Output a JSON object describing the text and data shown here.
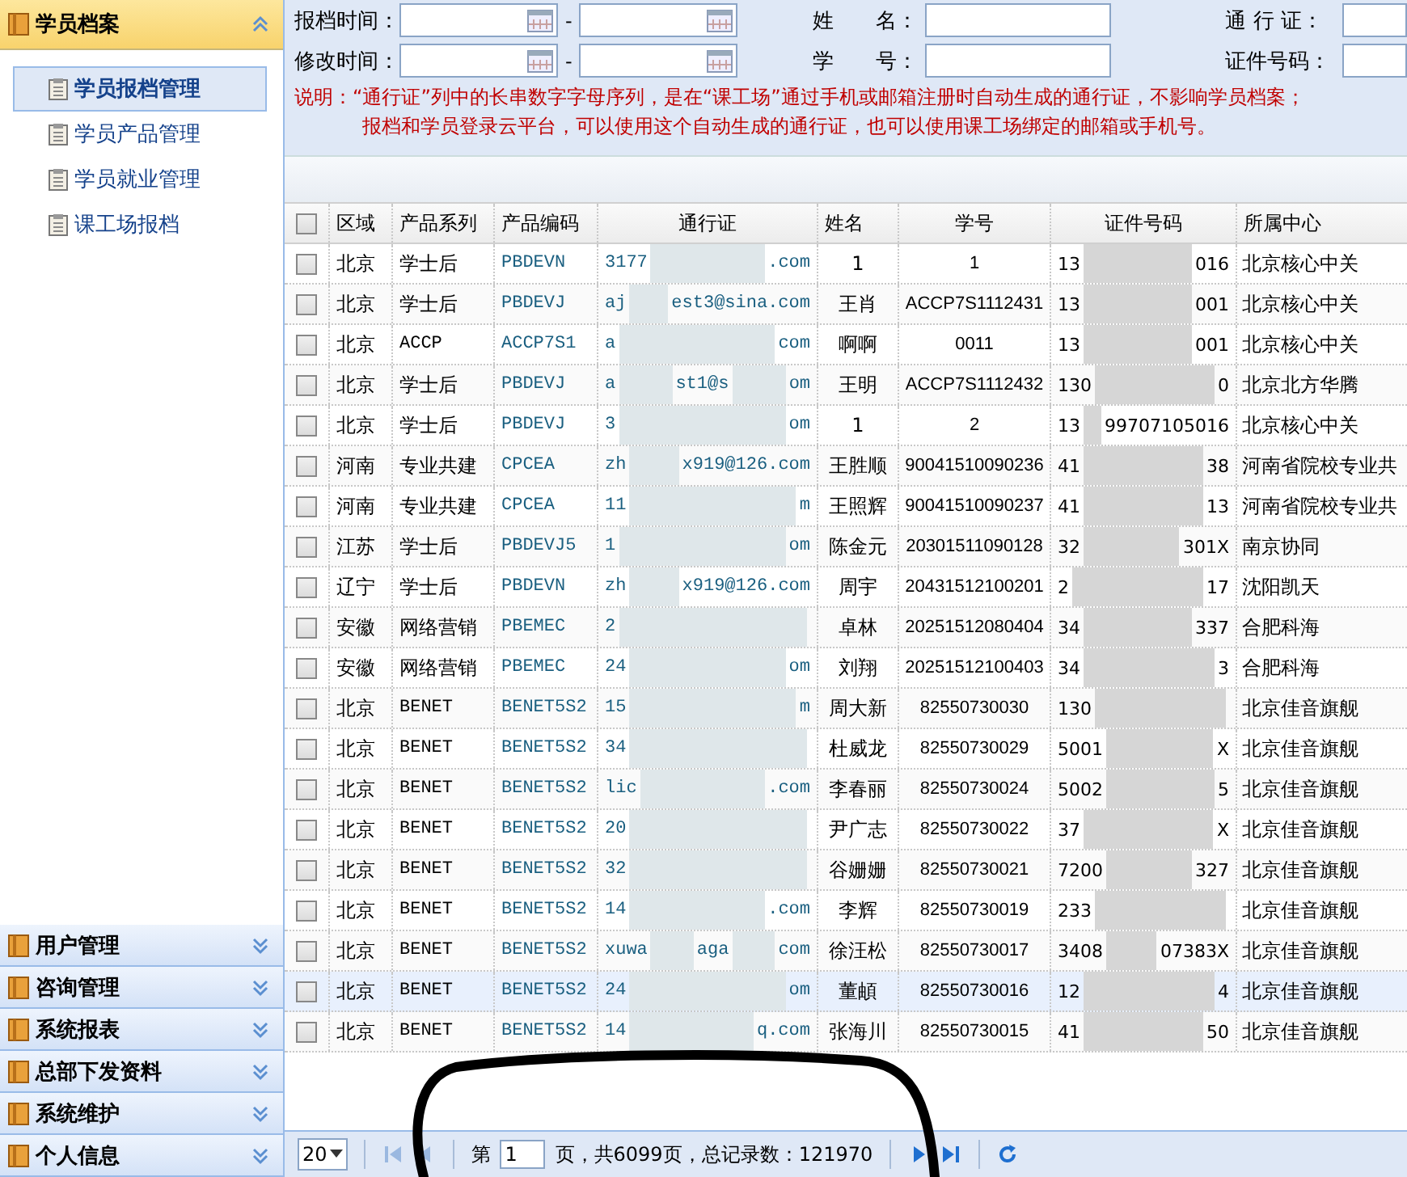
{
  "sidebar": {
    "open_section": {
      "title": "学员档案",
      "expanded": true,
      "items": [
        {
          "label": "学员报档管理",
          "selected": true
        },
        {
          "label": "学员产品管理",
          "selected": false
        },
        {
          "label": "学员就业管理",
          "selected": false
        },
        {
          "label": "课工场报档",
          "selected": false
        }
      ]
    },
    "sections": [
      {
        "title": "用户管理",
        "expanded": false
      },
      {
        "title": "咨询管理",
        "expanded": false
      },
      {
        "title": "系统报表",
        "expanded": false
      },
      {
        "title": "总部下发资料",
        "expanded": false
      },
      {
        "title": "系统维护",
        "expanded": false
      },
      {
        "title": "个人信息",
        "expanded": false
      }
    ]
  },
  "search": {
    "rows": [
      {
        "label": "报档时间：",
        "kind": "range",
        "label2": "姓　　名：",
        "label3": "通 行 证："
      },
      {
        "label": "修改时间：",
        "kind": "range",
        "label2": "学　　号：",
        "label3": "证件号码："
      }
    ],
    "range_separator": "-",
    "note": [
      "说明：“通行证”列中的长串数字字母序列，是在“课工场”通过手机或邮箱注册时自动生成的通行证，不影响学员档案；",
      "报档和学员登录云平台，可以使用这个自动生成的通行证，也可以使用课工场绑定的邮箱或手机号。"
    ]
  },
  "table": {
    "header_checked": false,
    "columns": [
      "区域",
      "产品系列",
      "产品编码",
      "通行证",
      "姓名",
      "学号",
      "证件号码",
      "所属中心"
    ],
    "rows": [
      {
        "checked": false,
        "selected": false,
        "region": "北京",
        "series": "学士后",
        "code": "PBDEVN",
        "pass": [
          "3177",
          ".com"
        ],
        "name": "1",
        "student_no": "1",
        "id_no": [
          "13",
          "016"
        ],
        "center": "北京核心中关"
      },
      {
        "checked": false,
        "selected": false,
        "region": "北京",
        "series": "学士后",
        "code": "PBDEVJ",
        "pass": [
          "aj",
          "est3@sina.com"
        ],
        "name": "王肖",
        "student_no": "ACCP7S1112431",
        "id_no": [
          "13",
          "001"
        ],
        "center": "北京核心中关"
      },
      {
        "checked": false,
        "selected": false,
        "region": "北京",
        "series": "ACCP",
        "code": "ACCP7S1",
        "pass": [
          "a",
          "com"
        ],
        "name": "啊啊",
        "student_no": "0011",
        "id_no": [
          "13",
          "001"
        ],
        "center": "北京核心中关"
      },
      {
        "checked": false,
        "selected": false,
        "region": "北京",
        "series": "学士后",
        "code": "PBDEVJ",
        "pass": [
          "a",
          "st1@s",
          "om"
        ],
        "name": "王明",
        "student_no": "ACCP7S1112432",
        "id_no": [
          "130",
          "0"
        ],
        "center": "北京北方华腾"
      },
      {
        "checked": false,
        "selected": false,
        "region": "北京",
        "series": "学士后",
        "code": "PBDEVJ",
        "pass": [
          "3",
          "om"
        ],
        "name": "1",
        "student_no": "2",
        "id_no": [
          "13",
          "99707105016"
        ],
        "center": "北京核心中关"
      },
      {
        "checked": false,
        "selected": false,
        "region": "河南",
        "series": "专业共建",
        "code": "CPCEA",
        "pass": [
          "zh",
          "x919@126.com"
        ],
        "name": "王胜顺",
        "student_no": "90041510090236",
        "id_no": [
          "41",
          "38"
        ],
        "center": "河南省院校专业共"
      },
      {
        "checked": false,
        "selected": false,
        "region": "河南",
        "series": "专业共建",
        "code": "CPCEA",
        "pass": [
          "11",
          "m"
        ],
        "name": "王照辉",
        "student_no": "90041510090237",
        "id_no": [
          "41",
          "13"
        ],
        "center": "河南省院校专业共"
      },
      {
        "checked": false,
        "selected": false,
        "region": "江苏",
        "series": "学士后",
        "code": "PBDEVJ5",
        "pass": [
          "1",
          "om"
        ],
        "name": "陈金元",
        "student_no": "20301511090128",
        "id_no": [
          "32",
          "301X"
        ],
        "center": "南京协同"
      },
      {
        "checked": false,
        "selected": false,
        "region": "辽宁",
        "series": "学士后",
        "code": "PBDEVN",
        "pass": [
          "zh",
          "x919@126.com"
        ],
        "name": "周宇",
        "student_no": "20431512100201",
        "id_no": [
          "2",
          "17"
        ],
        "center": "沈阳凯天"
      },
      {
        "checked": false,
        "selected": false,
        "region": "安徽",
        "series": "网络营销",
        "code": "PBEMEC",
        "pass": [
          "2"
        ],
        "name": "卓林",
        "student_no": "20251512080404",
        "id_no": [
          "34",
          "337"
        ],
        "center": "合肥科海"
      },
      {
        "checked": false,
        "selected": false,
        "region": "安徽",
        "series": "网络营销",
        "code": "PBEMEC",
        "pass": [
          "24",
          "om"
        ],
        "name": "刘翔",
        "student_no": "20251512100403",
        "id_no": [
          "34",
          "3"
        ],
        "center": "合肥科海"
      },
      {
        "checked": false,
        "selected": false,
        "region": "北京",
        "series": "BENET",
        "code": "BENET5S2",
        "pass": [
          "15",
          "m"
        ],
        "name": "周大新",
        "student_no": "82550730030",
        "id_no": [
          "130"
        ],
        "center": "北京佳音旗舰"
      },
      {
        "checked": false,
        "selected": false,
        "region": "北京",
        "series": "BENET",
        "code": "BENET5S2",
        "pass": [
          "34"
        ],
        "name": "杜威龙",
        "student_no": "82550730029",
        "id_no": [
          "5001",
          "X"
        ],
        "center": "北京佳音旗舰"
      },
      {
        "checked": false,
        "selected": false,
        "region": "北京",
        "series": "BENET",
        "code": "BENET5S2",
        "pass": [
          "lic",
          ".com"
        ],
        "name": "李春丽",
        "student_no": "82550730024",
        "id_no": [
          "5002",
          "5"
        ],
        "center": "北京佳音旗舰"
      },
      {
        "checked": false,
        "selected": false,
        "region": "北京",
        "series": "BENET",
        "code": "BENET5S2",
        "pass": [
          "20"
        ],
        "name": "尹广志",
        "student_no": "82550730022",
        "id_no": [
          "37",
          "X"
        ],
        "center": "北京佳音旗舰"
      },
      {
        "checked": false,
        "selected": false,
        "region": "北京",
        "series": "BENET",
        "code": "BENET5S2",
        "pass": [
          "32"
        ],
        "name": "谷姗姗",
        "student_no": "82550730021",
        "id_no": [
          "7200",
          "327"
        ],
        "center": "北京佳音旗舰"
      },
      {
        "checked": false,
        "selected": false,
        "region": "北京",
        "series": "BENET",
        "code": "BENET5S2",
        "pass": [
          "14",
          ".com"
        ],
        "name": "李辉",
        "student_no": "82550730019",
        "id_no": [
          "233"
        ],
        "center": "北京佳音旗舰"
      },
      {
        "checked": false,
        "selected": false,
        "region": "北京",
        "series": "BENET",
        "code": "BENET5S2",
        "pass": [
          "xuwa",
          "aga",
          "com"
        ],
        "name": "徐汪松",
        "student_no": "82550730017",
        "id_no": [
          "3408",
          "07383X"
        ],
        "center": "北京佳音旗舰"
      },
      {
        "checked": false,
        "selected": true,
        "region": "北京",
        "series": "BENET",
        "code": "BENET5S2",
        "pass": [
          "24",
          "om"
        ],
        "name": "董頔",
        "student_no": "82550730016",
        "id_no": [
          "12",
          "4"
        ],
        "center": "北京佳音旗舰"
      },
      {
        "checked": false,
        "selected": false,
        "region": "北京",
        "series": "BENET",
        "code": "BENET5S2",
        "pass": [
          "14",
          "q.com"
        ],
        "name": "张海川",
        "student_no": "82550730015",
        "id_no": [
          "41",
          "50"
        ],
        "center": "北京佳音旗舰"
      }
    ]
  },
  "pager": {
    "page_size": "20",
    "page_prefix": "第",
    "page": "1",
    "page_suffix": "页，共6099页，总记录数：121970"
  }
}
